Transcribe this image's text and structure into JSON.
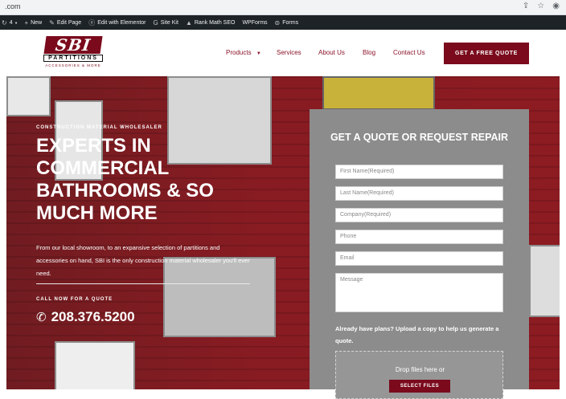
{
  "browser": {
    "url": ".com",
    "icons": [
      "share-icon",
      "star-icon",
      "profile-icon"
    ]
  },
  "wpbar": {
    "comments_count": "4",
    "new_label": "New",
    "edit_page_label": "Edit Page",
    "elementor_label": "Edit with Elementor",
    "sitekit_label": "Site Kit",
    "rankmath_label": "Rank Math SEO",
    "wpforms_label": "WPForms",
    "forms_label": "Forms"
  },
  "logo": {
    "brand": "SBI",
    "sub": "PARTITIONS",
    "tagline": "ACCESSORIES & MORE"
  },
  "nav": {
    "items": [
      "Products",
      "Services",
      "About Us",
      "Blog",
      "Contact Us"
    ],
    "cta": "GET A FREE QUOTE"
  },
  "hero": {
    "eyebrow": "CONSTRUCTION MATERIAL WHOLESALER",
    "headline": "EXPERTS IN COMMERCIAL BATHROOMS & SO MUCH MORE",
    "description": "From our local showroom, to an expansive selection of partitions and accessories on hand, SBI is the only construction material wholesaler you'll ever need.",
    "call_label": "CALL NOW FOR A QUOTE",
    "phone": "208.376.5200"
  },
  "form": {
    "title": "GET A QUOTE OR REQUEST REPAIR",
    "fields": {
      "first_name": "First Name(Required)",
      "last_name": "Last Name(Required)",
      "company": "Company(Required)",
      "phone": "Phone",
      "email": "Email",
      "message": "Message"
    },
    "upload_text": "Already have plans? Upload a copy to help us generate a quote.",
    "drop_text": "Drop files here or",
    "select_files": "SELECT FILES"
  }
}
